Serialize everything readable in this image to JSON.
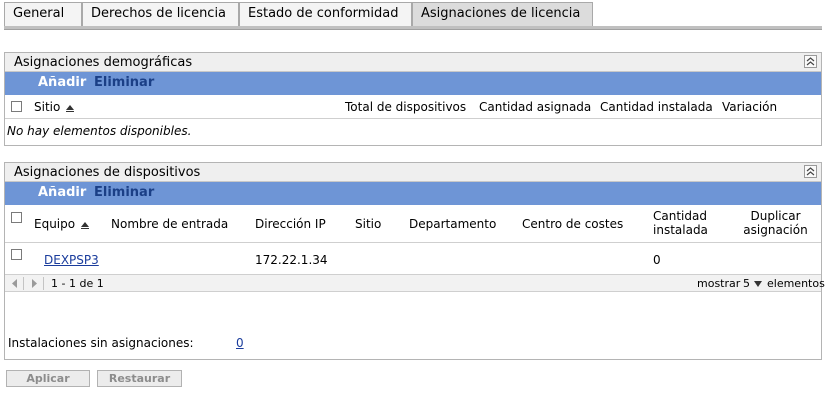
{
  "tabs": [
    {
      "label": "General"
    },
    {
      "label": "Derechos de licencia"
    },
    {
      "label": "Estado de conformidad"
    },
    {
      "label": "Asignaciones de licencia",
      "active": true
    }
  ],
  "demographic": {
    "title": "Asignaciones demográficas",
    "add_label": "Añadir",
    "remove_label": "Eliminar",
    "columns": {
      "site": "Sitio",
      "total_devices": "Total de dispositivos",
      "assigned_qty": "Cantidad asignada",
      "installed_qty": "Cantidad instalada",
      "variance": "Variación"
    },
    "empty_text": "No hay elementos disponibles."
  },
  "devices": {
    "title": "Asignaciones de dispositivos",
    "add_label": "Añadir",
    "remove_label": "Eliminar",
    "columns": {
      "device": "Equipo",
      "login_name": "Nombre de entrada",
      "ip_address": "Dirección IP",
      "site": "Sitio",
      "department": "Departamento",
      "cost_center": "Centro de costes",
      "installed_qty_1": "Cantidad",
      "installed_qty_2": "instalada",
      "dup_assign_1": "Duplicar",
      "dup_assign_2": "asignación"
    },
    "rows": [
      {
        "device": "DEXPSP3",
        "login_name": "",
        "ip_address": "172.22.1.34",
        "site": "",
        "department": "",
        "cost_center": "",
        "installed_qty": "0",
        "dup_assign": ""
      }
    ],
    "pager": {
      "range": "1 - 1 de 1",
      "show_label": "mostrar",
      "page_size": "5",
      "items_label": "elementos"
    },
    "unassigned_label": "Instalaciones sin asignaciones:",
    "unassigned_count": "0"
  },
  "buttons": {
    "apply": "Aplicar",
    "restore": "Restaurar"
  },
  "colors": {
    "action_bar": "#6e95d6",
    "link": "#1a3c9c"
  }
}
